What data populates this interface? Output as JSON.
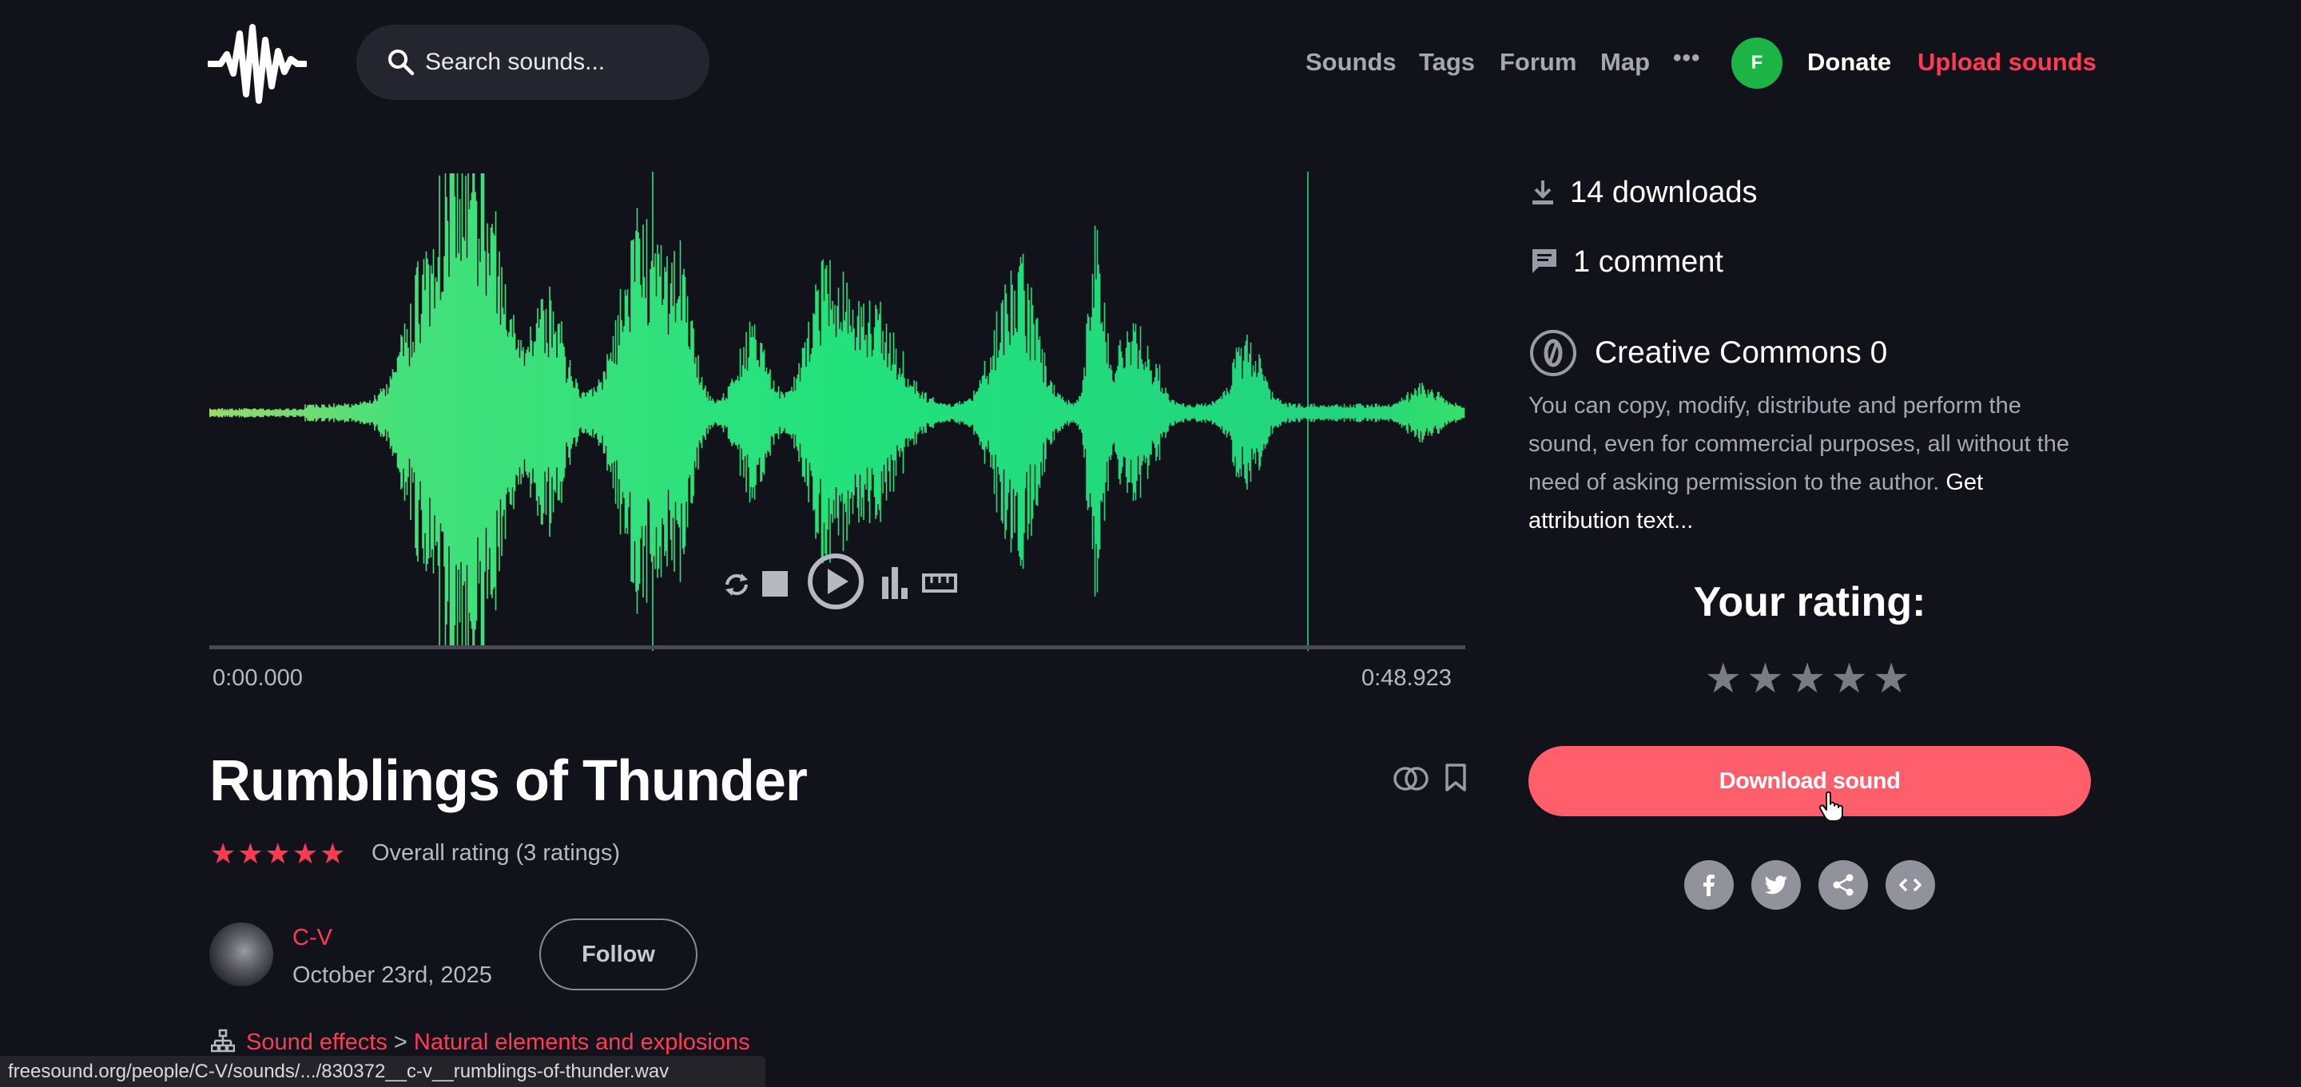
{
  "header": {
    "search_placeholder": "Search sounds...",
    "nav": [
      "Sounds",
      "Tags",
      "Forum",
      "Map"
    ],
    "more": "•••",
    "avatar_initial": "F",
    "donate": "Donate",
    "upload": "Upload sounds"
  },
  "player": {
    "time_start": "0:00.000",
    "time_end": "0:48.923",
    "progress": 0.0
  },
  "sound": {
    "title": "Rumblings of Thunder",
    "stars_overall": "★★★★★",
    "rating_value": 4.7,
    "rating_text": "Overall rating (3 ratings)",
    "username": "C-V",
    "date": "October 23rd, 2025",
    "follow_label": "Follow",
    "category": "Sound effects",
    "subcategory": "Natural elements and explosions",
    "category_separator": ">"
  },
  "sidebar": {
    "downloads": "14 downloads",
    "comments": "1 comment",
    "license_title": "Creative Commons 0",
    "license_text": "You can copy, modify, distribute and perform the sound, even for commercial purposes, all without the need of asking permission to the author.",
    "attribution_link": "Get attribution text...",
    "your_rating": "Your rating:",
    "rate_stars": "★★★★★",
    "download_label": "Download sound"
  },
  "status_bar": {
    "url": "freesound.org/people/C-V/sounds/.../830372__c-v__rumblings-of-thunder.wav"
  },
  "colors": {
    "background": "#12121b",
    "accent": "#ff3b54",
    "download_button": "#ff5e6a",
    "waveform": "#1fe37a",
    "avatar": "#1db446"
  }
}
